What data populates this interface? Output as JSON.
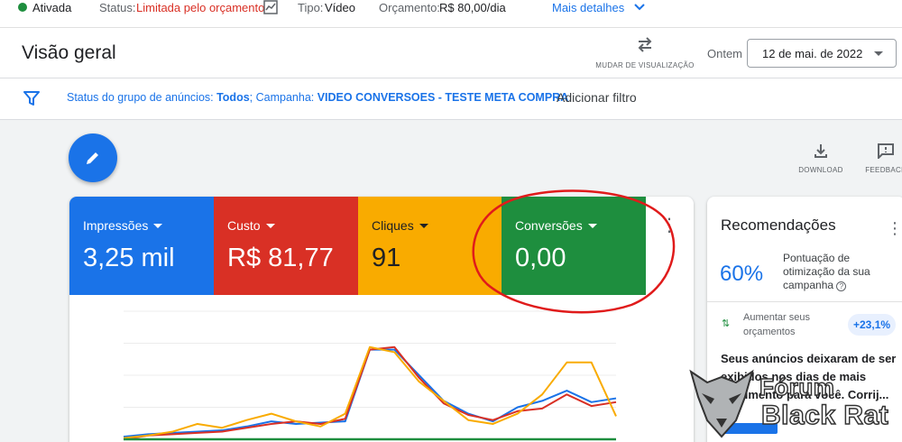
{
  "status_bar": {
    "state": "Ativada",
    "status_label": "Status:",
    "status_value": "Limitada pelo orçamento",
    "type_label": "Tipo:",
    "type_value": "Vídeo",
    "budget_label": "Orçamento:",
    "budget_value": "R$ 80,00/dia",
    "details_link": "Mais detalhes"
  },
  "header": {
    "title": "Visão geral",
    "switch_view_label": "MUDAR DE VISUALIZAÇÃO",
    "date_prefix": "Ontem",
    "date_value": "12 de mai. de 2022"
  },
  "filter_bar": {
    "filter_prefix": "Status do grupo de anúncios: ",
    "filter_status_value": "Todos",
    "filter_campaign_prefix": "; Campanha: ",
    "filter_campaign_value": "VIDEO CONVERSOES - TESTE META COMPRA",
    "add_filter": "Adicionar filtro"
  },
  "toolbar": {
    "download_label": "DOWNLOAD",
    "feedback_label": "FEEDBACK"
  },
  "metrics": [
    {
      "name": "Impressões",
      "value": "3,25 mil",
      "color": "#1a73e8"
    },
    {
      "name": "Custo",
      "value": "R$ 81,77",
      "color": "#d93025"
    },
    {
      "name": "Cliques",
      "value": "91",
      "color": "#f9ab00"
    },
    {
      "name": "Conversões",
      "value": "0,00",
      "color": "#1e8e3e"
    }
  ],
  "chart_data": {
    "type": "line",
    "x": [
      0,
      1,
      2,
      3,
      4,
      5,
      6,
      7,
      8,
      9,
      10,
      11,
      12,
      13,
      14,
      15,
      16,
      17,
      18,
      19,
      20
    ],
    "ylim": [
      0,
      1
    ],
    "grid": true,
    "series": [
      {
        "color": "#1a73e8",
        "values": [
          0.02,
          0.04,
          0.05,
          0.06,
          0.07,
          0.1,
          0.14,
          0.12,
          0.13,
          0.14,
          0.7,
          0.7,
          0.5,
          0.3,
          0.2,
          0.14,
          0.25,
          0.3,
          0.38,
          0.29,
          0.32
        ]
      },
      {
        "color": "#d93025",
        "values": [
          0.0,
          0.03,
          0.04,
          0.05,
          0.06,
          0.09,
          0.12,
          0.14,
          0.12,
          0.16,
          0.7,
          0.72,
          0.48,
          0.28,
          0.19,
          0.15,
          0.22,
          0.24,
          0.35,
          0.26,
          0.29
        ]
      },
      {
        "color": "#f9ab00",
        "values": [
          0.01,
          0.03,
          0.06,
          0.12,
          0.09,
          0.15,
          0.2,
          0.14,
          0.1,
          0.2,
          0.72,
          0.68,
          0.45,
          0.3,
          0.15,
          0.12,
          0.2,
          0.35,
          0.6,
          0.6,
          0.18
        ]
      },
      {
        "color": "#1e8e3e",
        "values": [
          0,
          0,
          0,
          0,
          0,
          0,
          0,
          0,
          0,
          0,
          0,
          0,
          0,
          0,
          0,
          0,
          0,
          0,
          0,
          0,
          0
        ]
      }
    ]
  },
  "recommendations": {
    "title": "Recomendações",
    "score": "60%",
    "score_label": "Pontuação de otimização da sua campanha",
    "item_label": "Aumentar seus orçamentos",
    "item_badge": "+23,1%",
    "description": "Seus anúncios deixaram de ser exibidos nos dias de mais movimento para você. Corrij..."
  },
  "watermark": {
    "line1": "Fórum",
    "line2": "Black Rat"
  }
}
